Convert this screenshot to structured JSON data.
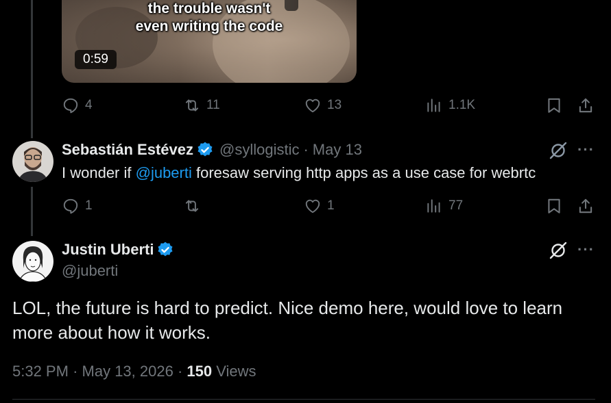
{
  "tweet1": {
    "video": {
      "caption_line1": "the trouble wasn't",
      "caption_line2": "even writing the code",
      "duration": "0:59"
    },
    "actions": {
      "replies": "4",
      "reposts": "11",
      "likes": "13",
      "views": "1.1K"
    }
  },
  "tweet2": {
    "author_name": "Sebastián Estévez",
    "handle": "@syllogistic",
    "separator": "·",
    "date": "May 13",
    "text_before": "I wonder if ",
    "mention": "@juberti",
    "text_after": " foresaw serving http apps as a use case for webrtc",
    "actions": {
      "replies": "1",
      "reposts": "",
      "likes": "1",
      "views": "77"
    }
  },
  "main_tweet": {
    "author_name": "Justin Uberti",
    "handle": "@juberti",
    "text": "LOL, the future is hard to predict. Nice demo here, would love to learn more about how it works.",
    "time": "5:32 PM",
    "date": "May 13, 2026",
    "separator": "·",
    "views_count": "150",
    "views_label": "Views"
  },
  "icons": [
    "reply-icon",
    "repost-icon",
    "like-icon",
    "views-icon",
    "bookmark-icon",
    "share-icon",
    "grok-icon",
    "more-icon",
    "verified-badge-icon"
  ],
  "colors": {
    "background": "#000000",
    "text": "#e7e9ea",
    "muted": "#71767b",
    "link": "#1d9bf0",
    "verified": "#1d9bf0"
  }
}
